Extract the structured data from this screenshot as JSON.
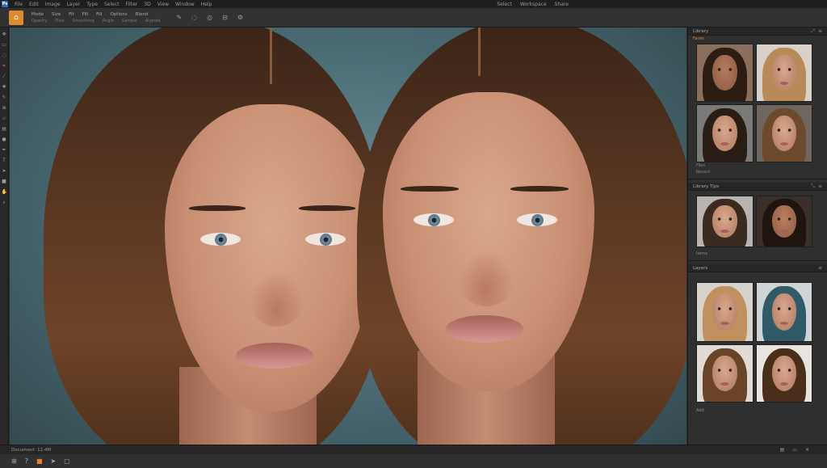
{
  "menubar": {
    "items": [
      "Ps",
      "File",
      "Edit",
      "Image",
      "Layer",
      "Type",
      "Select",
      "Filter",
      "3D",
      "View",
      "Window",
      "Help"
    ],
    "right_items": [
      "Select",
      "Workspace",
      "Share"
    ]
  },
  "options": {
    "row1": [
      "Mode",
      "Size",
      "Fit",
      "Fill",
      "Fill",
      "Options",
      "Blend"
    ],
    "row2": [
      "Opacity",
      "Flow",
      "Smoothing",
      "Angle",
      "Sample",
      "Aligned"
    ],
    "icons": [
      "brush-icon",
      "lasso-icon",
      "target-icon",
      "align-icon",
      "gear-icon"
    ]
  },
  "toolbar": {
    "tools": [
      "move",
      "marquee",
      "lasso",
      "crop",
      "eyedropper",
      "heal",
      "brush",
      "clone",
      "eraser",
      "gradient",
      "dodge",
      "pen",
      "type",
      "path",
      "shape",
      "hand",
      "zoom"
    ]
  },
  "panel": {
    "header1": "Library",
    "section1_label": "Faces",
    "section1_foot": [
      "Files",
      "Recent"
    ],
    "header2": "Library Tips",
    "section2_foot": "Items",
    "header3": "Layers",
    "section3_foot": "Add"
  },
  "status": {
    "zoom_info": "Document: 12.4M",
    "right_icons": [
      "layers-icon",
      "folder-icon",
      "trash-icon"
    ]
  },
  "dock": {
    "items": [
      "grid-icon",
      "help-icon",
      "home-icon",
      "cursor-icon",
      "frame-icon"
    ]
  },
  "colors": {
    "accent": "#e08a2e",
    "background": "#2b2b2b",
    "panel": "#2f2f2f"
  }
}
